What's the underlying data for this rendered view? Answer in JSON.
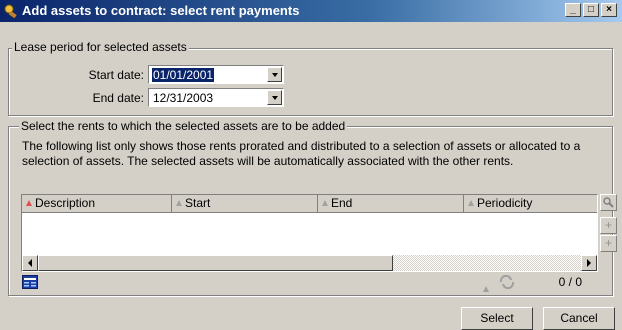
{
  "window": {
    "title": "Add assets to contract: select rent payments",
    "controls": {
      "minimize": "_",
      "maximize": "□",
      "close": "×"
    }
  },
  "lease": {
    "legend": "Lease period for selected assets",
    "start_label": "Start date:",
    "start_value": "01/01/2001",
    "end_label": "End date:",
    "end_value": "12/31/2003"
  },
  "rents": {
    "legend": "Select the rents to which the selected assets are to be added",
    "description_line1": "The following list only shows those rents prorated and distributed to a selection of assets or allocated to a",
    "description_line2": "selection of assets. The selected assets will be automatically associated with the other rents.",
    "columns": [
      "Description",
      "Start",
      "End",
      "Periodicity"
    ],
    "rows": [],
    "count": "0 / 0"
  },
  "buttons": {
    "select": "Select",
    "cancel": "Cancel"
  },
  "colors": {
    "title_gradient_start": "#0a246a",
    "title_gradient_end": "#a6caf0",
    "face": "#d4d0c8",
    "selection": "#0a246a"
  },
  "icons": [
    "app-icon",
    "search-icon",
    "plus-icon",
    "grid-icon",
    "sort-triangle-icon",
    "refresh-icon",
    "dropdown-arrow-icon",
    "scroll-left-icon",
    "scroll-right-icon"
  ]
}
